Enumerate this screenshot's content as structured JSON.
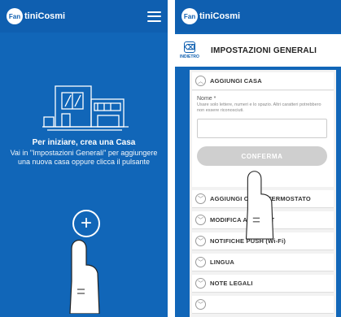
{
  "left_screen": {
    "brand_badge": "Fan",
    "brand_name": "tiniCosmi",
    "menu_icon": "hamburger-menu-icon",
    "intro_title": "Per iniziare, crea una Casa",
    "intro_text": "Vai in \"Impostazioni Generali\" per aggiungere una nuova casa oppure clicca il pulsante",
    "add_button_glyph": "+"
  },
  "right_screen": {
    "brand_badge": "Fan",
    "brand_name": "tiniCosmi",
    "back_icon_glyph": "⌫",
    "back_label": "INDIETRO",
    "page_title": "IMPOSTAZIONI GENERALI",
    "sections": [
      {
        "label": "AGGIUNGI CASA",
        "state": "expanded"
      },
      {
        "label": "AGGIUNGI CRONOTERMOSTATO",
        "state": "collapsed"
      },
      {
        "label": "MODIFICA ACCOUNT",
        "state": "collapsed"
      },
      {
        "label": "NOTIFICHE PUSH (Wi-Fi)",
        "state": "collapsed"
      },
      {
        "label": "LINGUA",
        "state": "collapsed"
      },
      {
        "label": "NOTE LEGALI",
        "state": "collapsed"
      }
    ],
    "form": {
      "name_label": "Nome *",
      "name_hint": "Usare solo lettere, numeri e lo spazio. Altri caratteri potrebbero non essere riconosciuti.",
      "name_value": "",
      "confirm_label": "CONFERMA"
    }
  },
  "colors": {
    "brand_blue": "#1166b8",
    "panel_gray": "#f2f2f2",
    "disabled_button": "#cfcfcf"
  }
}
